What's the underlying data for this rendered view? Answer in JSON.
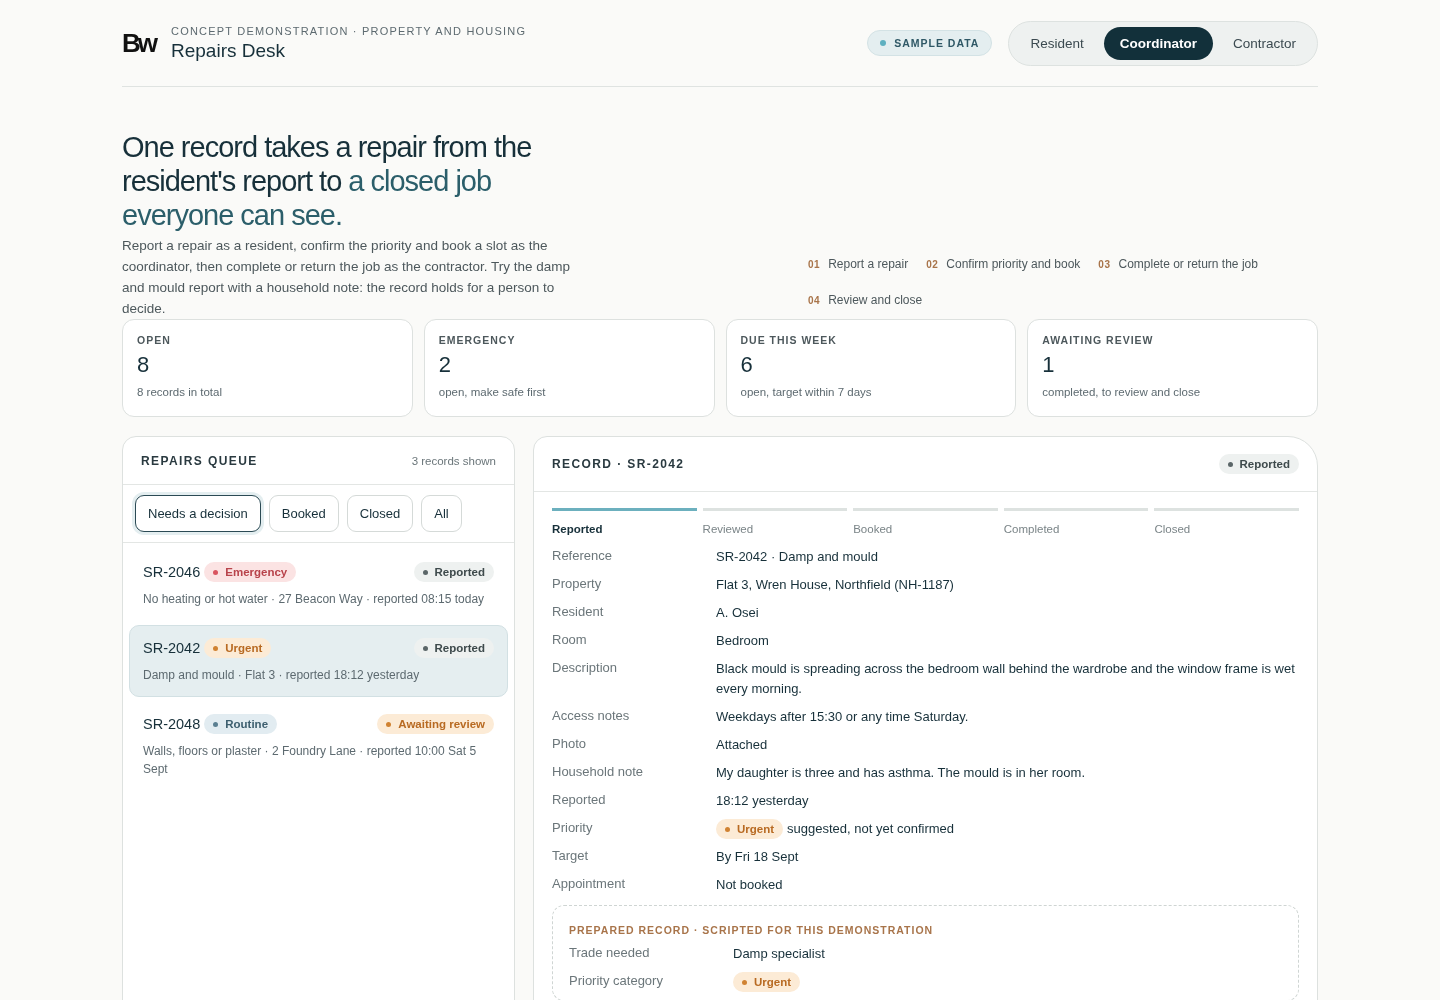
{
  "brand": {
    "logo": "Bw",
    "eyebrow": "CONCEPT DEMONSTRATION · PROPERTY AND HOUSING",
    "title": "Repairs Desk"
  },
  "sample_badge": "SAMPLE DATA",
  "roles": [
    {
      "label": "Resident",
      "selected": false
    },
    {
      "label": "Coordinator",
      "selected": true
    },
    {
      "label": "Contractor",
      "selected": false
    }
  ],
  "hero": {
    "headline": "One record takes a repair from the resident's report to",
    "headline_accent": "a closed job everyone can see.",
    "intro": "Report a repair as a resident, confirm the priority and book a slot as the coordinator, then complete or return the job as the contractor. Try the damp and mould report with a household note: the record holds for a person to decide."
  },
  "steps": [
    {
      "number": "01",
      "label": "Report a repair"
    },
    {
      "number": "02",
      "label": "Confirm priority and book"
    },
    {
      "number": "03",
      "label": "Complete or return the job"
    },
    {
      "number": "04",
      "label": "Review and close"
    }
  ],
  "stats": [
    {
      "label": "OPEN",
      "value": "8",
      "note": "8 records in total"
    },
    {
      "label": "EMERGENCY",
      "value": "2",
      "note": "open, make safe first"
    },
    {
      "label": "DUE THIS WEEK",
      "value": "6",
      "note": "open, target within 7 days"
    },
    {
      "label": "AWAITING REVIEW",
      "value": "1",
      "note": "completed, to review and close"
    }
  ],
  "queue": {
    "title": "REPAIRS QUEUE",
    "count": "3 records shown",
    "filters": [
      {
        "label": "Needs a decision",
        "selected": true
      },
      {
        "label": "Booked",
        "selected": false
      },
      {
        "label": "Closed",
        "selected": false
      },
      {
        "label": "All",
        "selected": false
      }
    ],
    "rows": [
      {
        "ref": "SR-2046",
        "priority": {
          "label": "Emergency",
          "kind": "emergency"
        },
        "status": {
          "label": "Reported",
          "kind": "neutral"
        },
        "summary": "No heating or hot water · 27 Beacon Way · reported 08:15 today",
        "selected": false
      },
      {
        "ref": "SR-2042",
        "priority": {
          "label": "Urgent",
          "kind": "urgent"
        },
        "status": {
          "label": "Reported",
          "kind": "neutral"
        },
        "summary": "Damp and mould · Flat 3 · reported 18:12 yesterday",
        "selected": true
      },
      {
        "ref": "SR-2048",
        "priority": {
          "label": "Routine",
          "kind": "routine"
        },
        "status": {
          "label": "Awaiting review",
          "kind": "urgent"
        },
        "summary": "Walls, floors or plaster · 2 Foundry Lane · reported 10:00 Sat 5 Sept",
        "selected": false
      }
    ]
  },
  "record": {
    "title": "RECORD · SR-2042",
    "status": {
      "label": "Reported",
      "kind": "neutral"
    },
    "stages": [
      {
        "label": "Reported",
        "selected": true
      },
      {
        "label": "Reviewed",
        "selected": false
      },
      {
        "label": "Booked",
        "selected": false
      },
      {
        "label": "Completed",
        "selected": false
      },
      {
        "label": "Closed",
        "selected": false
      }
    ],
    "fields": [
      {
        "label": "Reference",
        "value": "SR-2042 · Damp and mould"
      },
      {
        "label": "Property",
        "value": "Flat 3, Wren House, Northfield (NH-1187)"
      },
      {
        "label": "Resident",
        "value": "A. Osei"
      },
      {
        "label": "Room",
        "value": "Bedroom"
      },
      {
        "label": "Description",
        "value": "Black mould is spreading across the bedroom wall behind the wardrobe and the window frame is wet every morning."
      },
      {
        "label": "Access notes",
        "value": "Weekdays after 15:30 or any time Saturday."
      },
      {
        "label": "Photo",
        "value": "Attached"
      },
      {
        "label": "Household note",
        "value": "My daughter is three and has asthma. The mould is in her room."
      },
      {
        "label": "Reported",
        "value": "18:12 yesterday"
      },
      {
        "label": "Priority",
        "pill": {
          "label": "Urgent",
          "kind": "urgent"
        },
        "value": "suggested, not yet confirmed"
      },
      {
        "label": "Target",
        "value": "By Fri 18 Sept"
      },
      {
        "label": "Appointment",
        "value": "Not booked"
      }
    ],
    "prepared": {
      "title": "PREPARED RECORD · SCRIPTED FOR THIS DEMONSTRATION",
      "fields": [
        {
          "label": "Trade needed",
          "value": "Damp specialist"
        },
        {
          "label": "Priority category",
          "pill": {
            "label": "Urgent",
            "kind": "urgent"
          }
        }
      ]
    }
  }
}
